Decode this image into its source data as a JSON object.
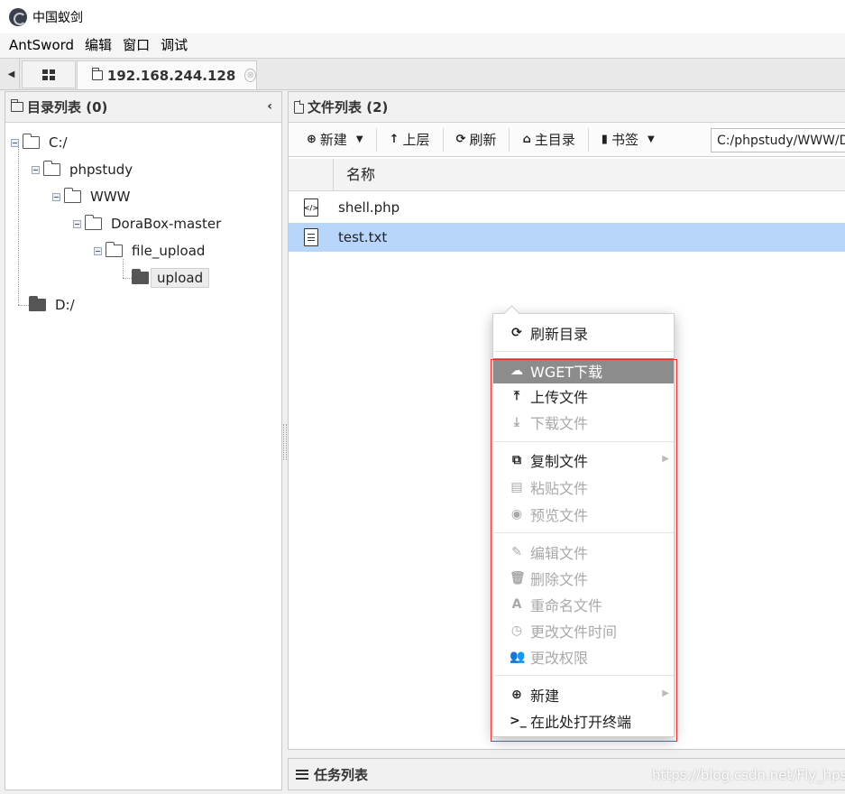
{
  "window": {
    "title": "中国蚁剑"
  },
  "menubar": {
    "items": [
      "AntSword",
      "编辑",
      "窗口",
      "调试"
    ]
  },
  "tabs": {
    "active_label": "192.168.244.128",
    "close_glyph": "⊗"
  },
  "left_panel": {
    "title": "目录列表 (0)",
    "collapse_glyph": "‹",
    "tree": [
      {
        "label": "C:/",
        "depth": 0,
        "expanded": true
      },
      {
        "label": "phpstudy",
        "depth": 1,
        "expanded": true
      },
      {
        "label": "WWW",
        "depth": 2,
        "expanded": true
      },
      {
        "label": "DoraBox-master",
        "depth": 3,
        "expanded": true
      },
      {
        "label": "file_upload",
        "depth": 4,
        "expanded": true
      },
      {
        "label": "upload",
        "depth": 5,
        "selected": true
      },
      {
        "label": "D:/",
        "depth": 0
      }
    ]
  },
  "right_panel": {
    "title": "文件列表 (2)",
    "toolbar": {
      "new_label": "新建",
      "up_label": "上层",
      "refresh_label": "刷新",
      "home_label": "主目录",
      "bookmark_label": "书签",
      "path_value": "C:/phpstudy/WWW/DoraBox-master/file_upload/upload/"
    },
    "columns": {
      "name": "名称"
    },
    "files": [
      {
        "name": "shell.php",
        "type": "code",
        "selected": false
      },
      {
        "name": "test.txt",
        "type": "text",
        "selected": true
      }
    ]
  },
  "context_menu": {
    "items": [
      {
        "label": "刷新目录",
        "icon": "refresh-icon",
        "glyph": "⟳",
        "enabled": true
      },
      {
        "label": "WGET下载",
        "icon": "cloud-download-icon",
        "glyph": "☁",
        "enabled": true,
        "highlighted": true
      },
      {
        "label": "上传文件",
        "icon": "upload-icon",
        "glyph": "⤒",
        "enabled": true
      },
      {
        "label": "下载文件",
        "icon": "download-icon",
        "glyph": "⤓",
        "enabled": false
      },
      {
        "label": "复制文件",
        "icon": "copy-icon",
        "glyph": "⧉",
        "enabled": true,
        "submenu": true
      },
      {
        "label": "粘贴文件",
        "icon": "paste-icon",
        "glyph": "▤",
        "enabled": false
      },
      {
        "label": "预览文件",
        "icon": "eye-icon",
        "glyph": "◉",
        "enabled": false
      },
      {
        "label": "编辑文件",
        "icon": "edit-icon",
        "glyph": "✎",
        "enabled": false
      },
      {
        "label": "删除文件",
        "icon": "trash-icon",
        "glyph": "🗑",
        "enabled": false
      },
      {
        "label": "重命名文件",
        "icon": "font-icon",
        "glyph": "A",
        "enabled": false
      },
      {
        "label": "更改文件时间",
        "icon": "clock-icon",
        "glyph": "◷",
        "enabled": false
      },
      {
        "label": "更改权限",
        "icon": "users-icon",
        "glyph": "👥",
        "enabled": false
      },
      {
        "label": "新建",
        "icon": "plus-circle-icon",
        "glyph": "⊕",
        "enabled": true,
        "submenu": true
      },
      {
        "label": "在此处打开终端",
        "icon": "terminal-icon",
        "glyph": ">_",
        "enabled": true
      }
    ]
  },
  "task_panel": {
    "title": "任务列表"
  },
  "watermark": {
    "text": "https://blog.csdn.net/Fly_hps"
  },
  "colors": {
    "selection": "#b8d6fb",
    "menu_highlight": "#8c8c8c",
    "annotation_box": "#e03030"
  }
}
